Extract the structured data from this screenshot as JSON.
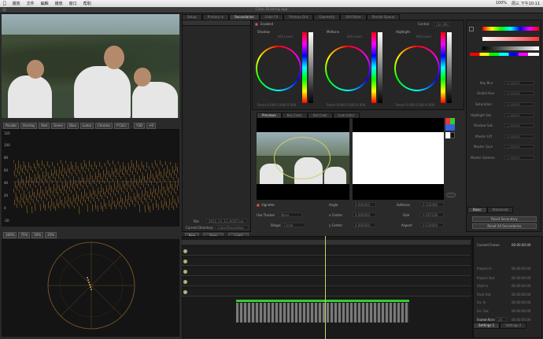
{
  "menubar": {
    "apple": "",
    "items": [
      "播放",
      "文件",
      "編輯",
      "播放",
      "窗口",
      "帮助"
    ],
    "status": "100%",
    "clock": "周三 下午10:11"
  },
  "window": {
    "title": "Color Grading app"
  },
  "left_tools": {
    "scope_buttons": [
      "Parade",
      "Overlay",
      "Red",
      "Green",
      "Blue",
      "Luma",
      "Chroma",
      "Y'CbCr"
    ],
    "scope_right": [
      "Y3D",
      "+6"
    ],
    "scale_top": "120",
    "scale_labels": [
      "100",
      "80",
      "60",
      "40",
      "20",
      "0",
      "-20"
    ],
    "zoom_buttons": [
      "100%",
      "75%",
      "50%",
      "25%"
    ]
  },
  "top_tabs": [
    "Setup",
    "Primary In",
    "Secondaries",
    "Color FX",
    "Primary Out",
    "Geometry",
    "Still Store",
    "Render Queue"
  ],
  "secondary": {
    "enabled_label": "Enabled",
    "control_label": "Control",
    "control_value": "Ctrl (M)",
    "wheels": [
      {
        "name": "Shadow",
        "hue_label": "H/S Level",
        "reset": "Reset  0.000  0.000  0.000"
      },
      {
        "name": "Midtone",
        "hue_label": "H/S Level",
        "reset": "Reset  0.000  0.000  0.000"
      },
      {
        "name": "Highlight",
        "hue_label": "H/S Level",
        "reset": "Reset  0.000  0.000  0.000"
      }
    ]
  },
  "preview_tabs": [
    "Previews",
    "Key Color",
    "Sat  Color",
    "Lum Color"
  ],
  "vignette": {
    "label": "Vignette",
    "angle_label": "Angle",
    "angle_val": "0.000000",
    "softness_label": "Softness",
    "softness_val": "0.320496",
    "xcenter_label": "x Center",
    "xcenter_val": "0.000000",
    "size_label": "Size",
    "size_val": "0.567238",
    "ycenter_label": "y Center",
    "ycenter_val": "0.000000",
    "aspect_label": "Aspect",
    "aspect_val": "0.530000",
    "tracker_label": "Use Tracker",
    "tracker_val": "None",
    "shape_label": "Shape",
    "shape_val": "Circle"
  },
  "file_info": {
    "file_label": "File",
    "file_val": "2012_12_13_HCDT.sss",
    "dir_label": "Current Directory",
    "dir_val": "Color/Secondary"
  },
  "bottom_buttons": [
    "New",
    "Save",
    "Load"
  ],
  "right_panel": {
    "sliders": [
      {
        "label": "Key Blur",
        "value": "0.000000"
      },
      {
        "label": "Global Hue",
        "value": "0.000000"
      },
      {
        "label": "Saturation",
        "value": "1.000000"
      },
      {
        "label": "Highlight Sat.",
        "value": "1.000000"
      },
      {
        "label": "Shadow Sat.",
        "value": "1.000000"
      },
      {
        "label": "Master Lift",
        "value": "0.000000"
      },
      {
        "label": "Master Gain",
        "value": "1.000000"
      },
      {
        "label": "Master Gamma",
        "value": "1.000000"
      }
    ],
    "basic_tab": "Basic",
    "advanced_tab": "Advanced",
    "reset_secondary": "Reset Secondary",
    "reset_all": "Reset All Secondaries"
  },
  "timeline_info": {
    "current_frame_label": "Current Frame",
    "current_frame_val": "00:00:00:00",
    "rows": [
      {
        "label": "Project In",
        "value": "00:00:00:00"
      },
      {
        "label": "Project Out",
        "value": "00:00:00:00"
      },
      {
        "label": "Shot In",
        "value": "00:00:00:00"
      },
      {
        "label": "Shot Out",
        "value": "00:00:00:00"
      },
      {
        "label": "Src In",
        "value": "00:00:00:00"
      },
      {
        "label": "Src Out",
        "value": "00:00:00:00"
      },
      {
        "label": "Duration",
        "value": "00:00:00:00"
      }
    ],
    "frame_rate_label": "Frame Rate",
    "frame_rate_val": "24",
    "settings_tabs": [
      "Settings 1",
      "Settings 2"
    ]
  },
  "colors": {
    "accent": "#cfcf6a",
    "panel": "#222222",
    "scope_trace": "#c8872f",
    "vector_trace": "#d9a35a"
  }
}
